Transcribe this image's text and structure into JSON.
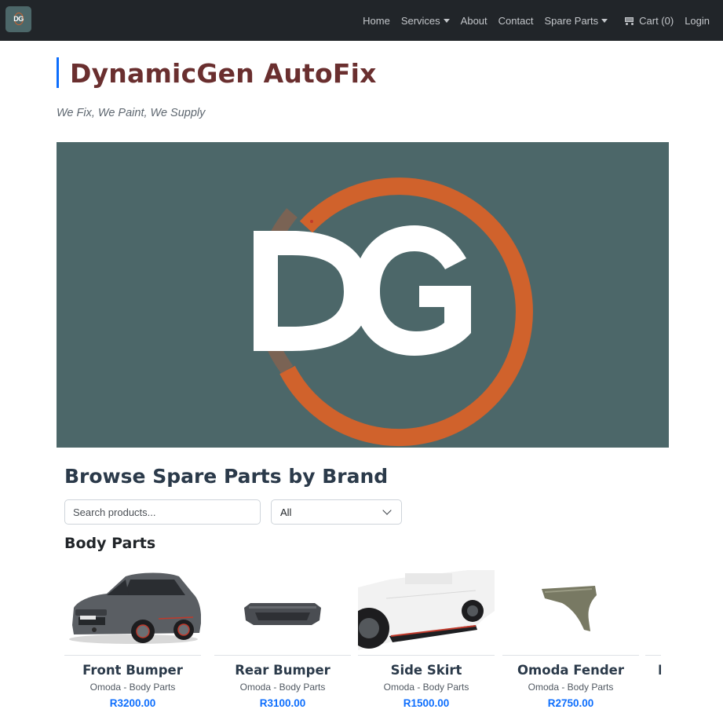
{
  "navbar": {
    "logo_text": "DG",
    "links": {
      "home": "Home",
      "services": "Services",
      "about": "About",
      "contact": "Contact",
      "spare_parts": "Spare Parts",
      "cart": "Cart (0)",
      "login": "Login"
    }
  },
  "header": {
    "title": "DynamicGen AutoFix",
    "tagline": "We Fix, We Paint, We Supply"
  },
  "hero": {
    "logo_text": "DG",
    "background_color": "#4c6769",
    "ring_color": "#d0622c"
  },
  "browse": {
    "title": "Browse Spare Parts by Brand",
    "search_placeholder": "Search products...",
    "brand_filter_value": "All",
    "category": "Body Parts"
  },
  "products": [
    {
      "name": "Front Bumper",
      "subtitle": "Omoda - Body Parts",
      "price": "R3200.00"
    },
    {
      "name": "Rear Bumper",
      "subtitle": "Omoda - Body Parts",
      "price": "R3100.00"
    },
    {
      "name": "Side Skirt",
      "subtitle": "Omoda - Body Parts",
      "price": "R1500.00"
    },
    {
      "name": "Omoda Fender",
      "subtitle": "Omoda - Body Parts",
      "price": "R2750.00"
    }
  ],
  "partial_product_name": "I",
  "colors": {
    "navbar": "#212529",
    "accent": "#0d6efd",
    "title": "#6a2f2f"
  }
}
